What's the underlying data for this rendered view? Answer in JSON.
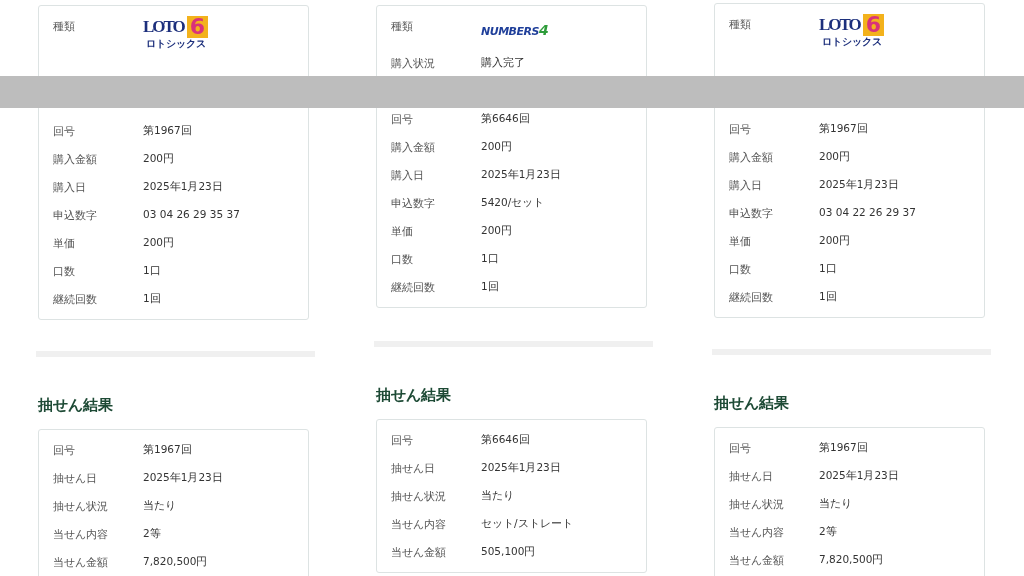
{
  "columns": [
    {
      "purchase": {
        "type_label": "種類",
        "logo": {
          "kind": "loto6",
          "name": "LOTO",
          "number": "6",
          "sub": "ロトシックス"
        },
        "rows": [
          {
            "label": "回号",
            "value": "第1967回"
          },
          {
            "label": "購入金額",
            "value": "200円"
          },
          {
            "label": "購入日",
            "value": "2025年1月23日"
          },
          {
            "label": "申込数字",
            "value": "03 04 26 29 35 37"
          },
          {
            "label": "単価",
            "value": "200円"
          },
          {
            "label": "口数",
            "value": "1口"
          },
          {
            "label": "継続回数",
            "value": "1回"
          }
        ]
      },
      "result_title": "抽せん結果",
      "result": [
        {
          "label": "回号",
          "value": "第1967回"
        },
        {
          "label": "抽せん日",
          "value": "2025年1月23日"
        },
        {
          "label": "抽せん状況",
          "value": "当たり"
        },
        {
          "label": "当せん内容",
          "value": "2等"
        },
        {
          "label": "当せん金額",
          "value": "7,820,500円"
        }
      ]
    },
    {
      "purchase": {
        "type_label": "種類",
        "logo": {
          "kind": "numbers4",
          "name": "NUMBERS",
          "number": "4"
        },
        "rows_above": [
          {
            "label": "購入状況",
            "value": "購入完了"
          }
        ],
        "rows": [
          {
            "label": "回号",
            "value": "第6646回"
          },
          {
            "label": "購入金額",
            "value": "200円"
          },
          {
            "label": "購入日",
            "value": "2025年1月23日"
          },
          {
            "label": "申込数字",
            "value": "5420/セット"
          },
          {
            "label": "単価",
            "value": "200円"
          },
          {
            "label": "口数",
            "value": "1口"
          },
          {
            "label": "継続回数",
            "value": "1回"
          }
        ]
      },
      "result_title": "抽せん結果",
      "result": [
        {
          "label": "回号",
          "value": "第6646回"
        },
        {
          "label": "抽せん日",
          "value": "2025年1月23日"
        },
        {
          "label": "抽せん状況",
          "value": "当たり"
        },
        {
          "label": "当せん内容",
          "value": "セット/ストレート"
        },
        {
          "label": "当せん金額",
          "value": "505,100円"
        }
      ]
    },
    {
      "purchase": {
        "type_label": "種類",
        "logo": {
          "kind": "loto6",
          "name": "LOTO",
          "number": "6",
          "sub": "ロトシックス"
        },
        "rows": [
          {
            "label": "回号",
            "value": "第1967回"
          },
          {
            "label": "購入金額",
            "value": "200円"
          },
          {
            "label": "購入日",
            "value": "2025年1月23日"
          },
          {
            "label": "申込数字",
            "value": "03 04 22 26 29 37"
          },
          {
            "label": "単価",
            "value": "200円"
          },
          {
            "label": "口数",
            "value": "1口"
          },
          {
            "label": "継続回数",
            "value": "1回"
          }
        ]
      },
      "result_title": "抽せん結果",
      "result": [
        {
          "label": "回号",
          "value": "第1967回"
        },
        {
          "label": "抽せん日",
          "value": "2025年1月23日"
        },
        {
          "label": "抽せん状況",
          "value": "当たり"
        },
        {
          "label": "当せん内容",
          "value": "2等"
        },
        {
          "label": "当せん金額",
          "value": "7,820,500円"
        }
      ]
    }
  ]
}
